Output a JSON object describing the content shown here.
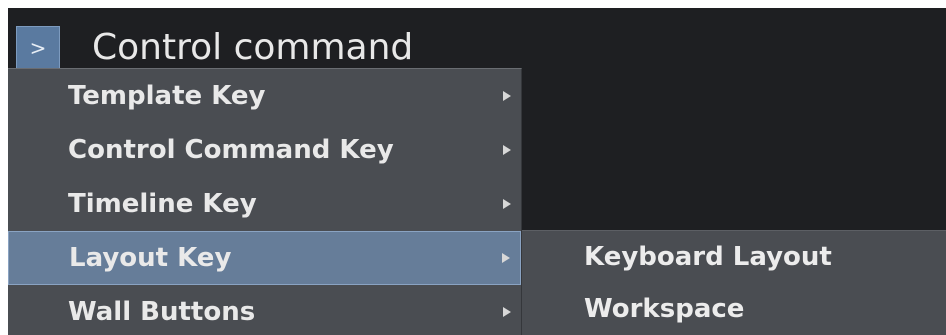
{
  "header": {
    "expand_icon": "chevron-right-icon",
    "expand_glyph": ">",
    "title": "Control command"
  },
  "menu": {
    "items": [
      {
        "label": "Template Key",
        "has_submenu": true
      },
      {
        "label": "Control Command Key",
        "has_submenu": true
      },
      {
        "label": "Timeline Key",
        "has_submenu": true
      },
      {
        "label": "Layout Key",
        "has_submenu": true,
        "active": true
      },
      {
        "label": "Wall Buttons",
        "has_submenu": true
      }
    ]
  },
  "submenu": {
    "items": [
      {
        "label": "Keyboard Layout"
      },
      {
        "label": "Workspace"
      }
    ]
  },
  "colors": {
    "background": "#1e1f22",
    "menu_background": "#4a4d52",
    "active_item": "#667d99",
    "button": "#5a7aa0",
    "text": "#e9e9e9"
  }
}
